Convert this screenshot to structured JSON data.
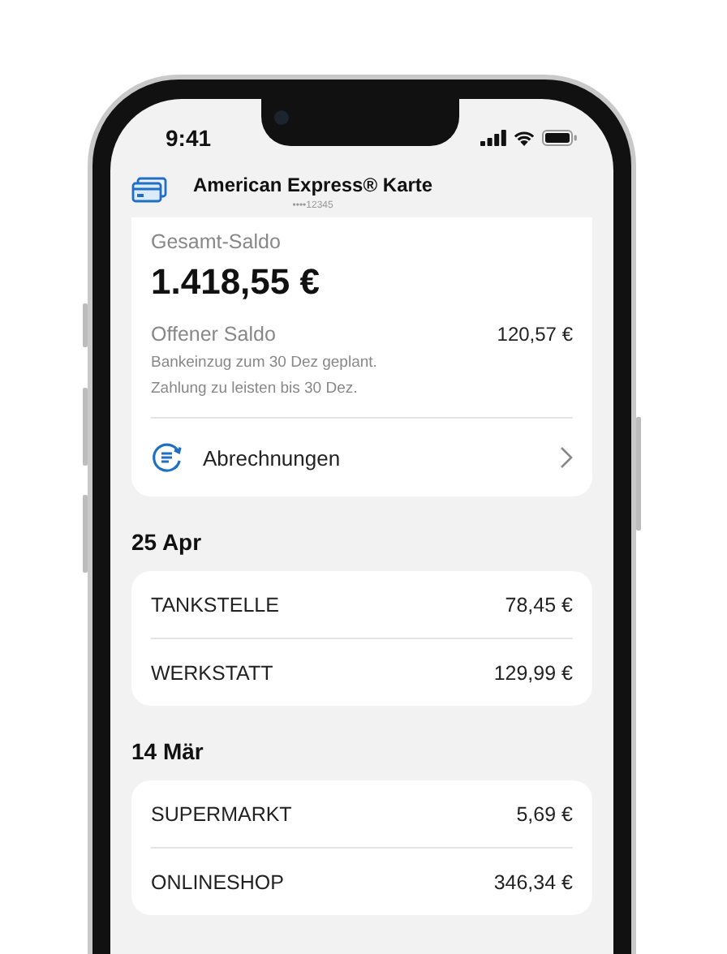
{
  "status_bar": {
    "time": "9:41"
  },
  "header": {
    "title": "American Express® Karte",
    "card_number": "••••12345"
  },
  "balance": {
    "label": "Gesamt-Saldo",
    "amount": "1.418,55 €",
    "open_label": "Offener Saldo",
    "open_amount": "120,57 €",
    "notes": [
      "Bankeinzug zum 30 Dez geplant.",
      "Zahlung zu leisten bis 30 Dez."
    ],
    "link": "Abrechnungen"
  },
  "groups": [
    {
      "date": "25 Apr",
      "transactions": [
        {
          "merchant": "TANKSTELLE",
          "amount": "78,45 €"
        },
        {
          "merchant": "WERKSTATT",
          "amount": "129,99 €"
        }
      ]
    },
    {
      "date": "14 Mär",
      "transactions": [
        {
          "merchant": "SUPERMARKT",
          "amount": "5,69 €"
        },
        {
          "merchant": "ONLINESHOP",
          "amount": "346,34 €"
        }
      ]
    }
  ]
}
